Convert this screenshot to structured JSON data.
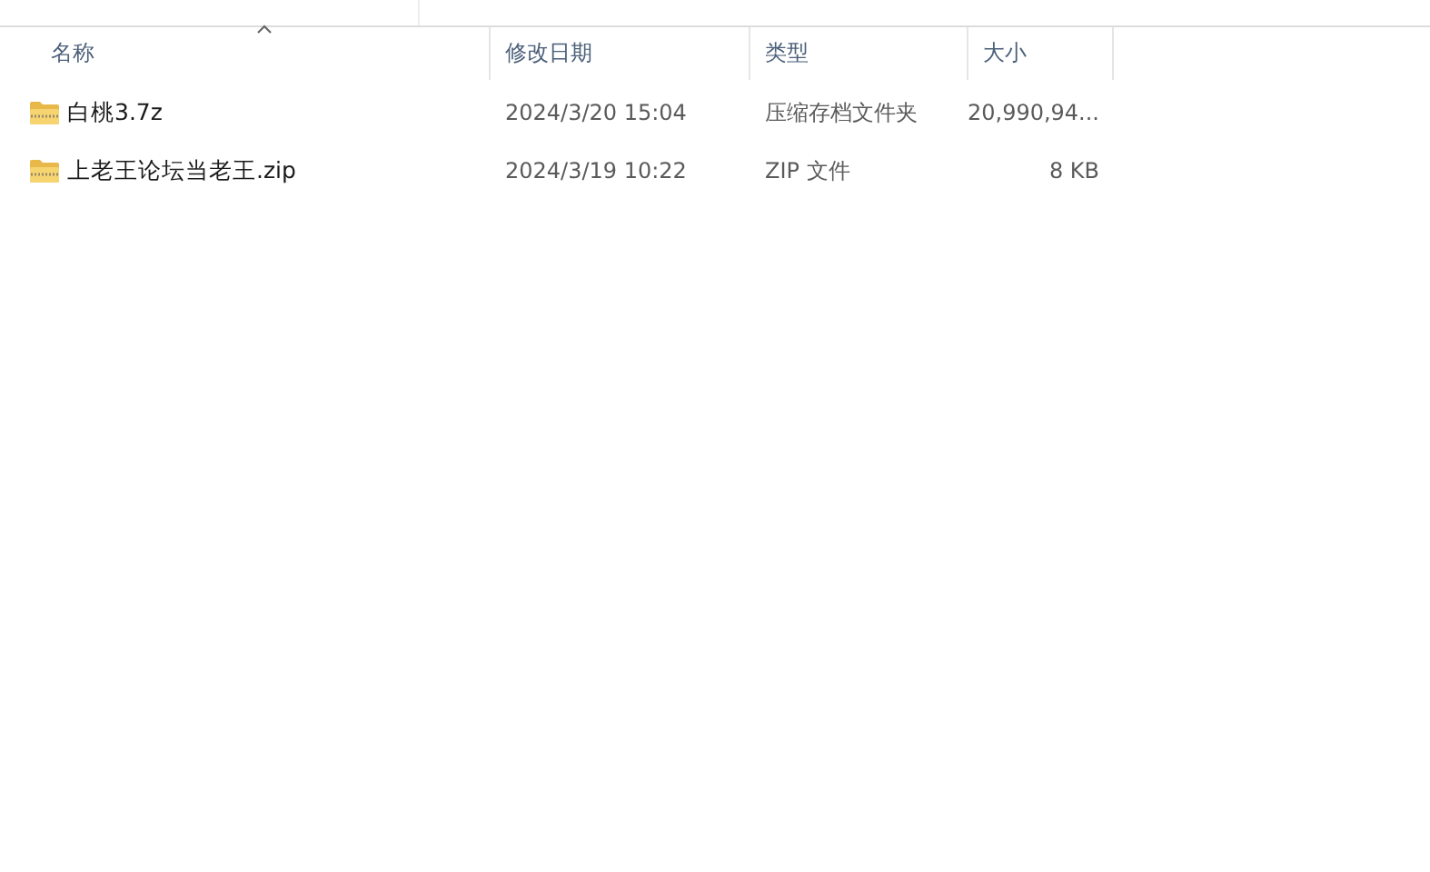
{
  "table": {
    "columns": [
      {
        "label": "名称",
        "sorted": true
      },
      {
        "label": "修改日期",
        "sorted": false
      },
      {
        "label": "类型",
        "sorted": false
      },
      {
        "label": "大小",
        "sorted": false
      }
    ],
    "rows": [
      {
        "name": "白桃3.7z",
        "modified": "2024/3/20 15:04",
        "type": "压缩存档文件夹",
        "size": "20,990,94..."
      },
      {
        "name": "上老王论坛当老王.zip",
        "modified": "2024/3/19 10:22",
        "type": "ZIP 文件",
        "size": "8 KB"
      }
    ]
  }
}
